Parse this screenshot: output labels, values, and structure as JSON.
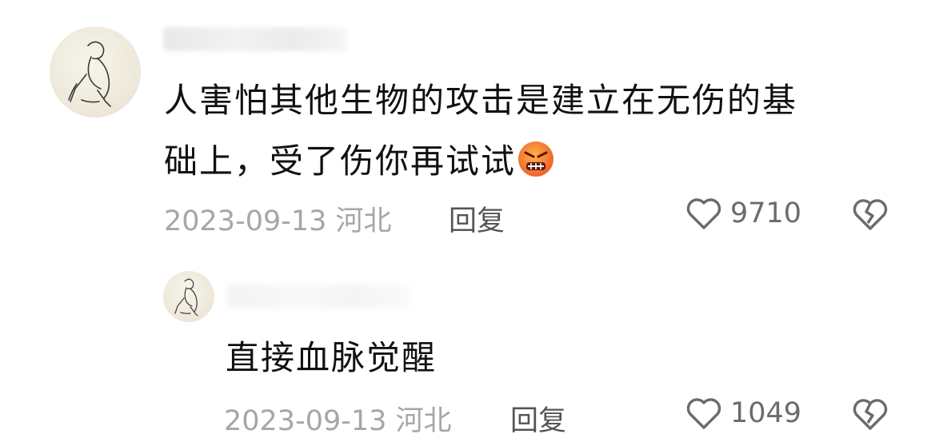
{
  "comment": {
    "text_line1": "人害怕其他生物的攻击是建立在无伤的基",
    "text_line2": "础上，受了伤你再试试",
    "emoji": "angry-face-icon",
    "date": "2023-09-13",
    "location": "河北",
    "reply_label": "回复",
    "likes": "9710"
  },
  "reply": {
    "text": "直接血脉觉醒",
    "date": "2023-09-13",
    "location": "河北",
    "reply_label": "回复",
    "likes": "1049"
  },
  "colors": {
    "meta_gray": "#a6a6a6",
    "text": "#111111",
    "emoji_orange": "#f07a2a"
  }
}
